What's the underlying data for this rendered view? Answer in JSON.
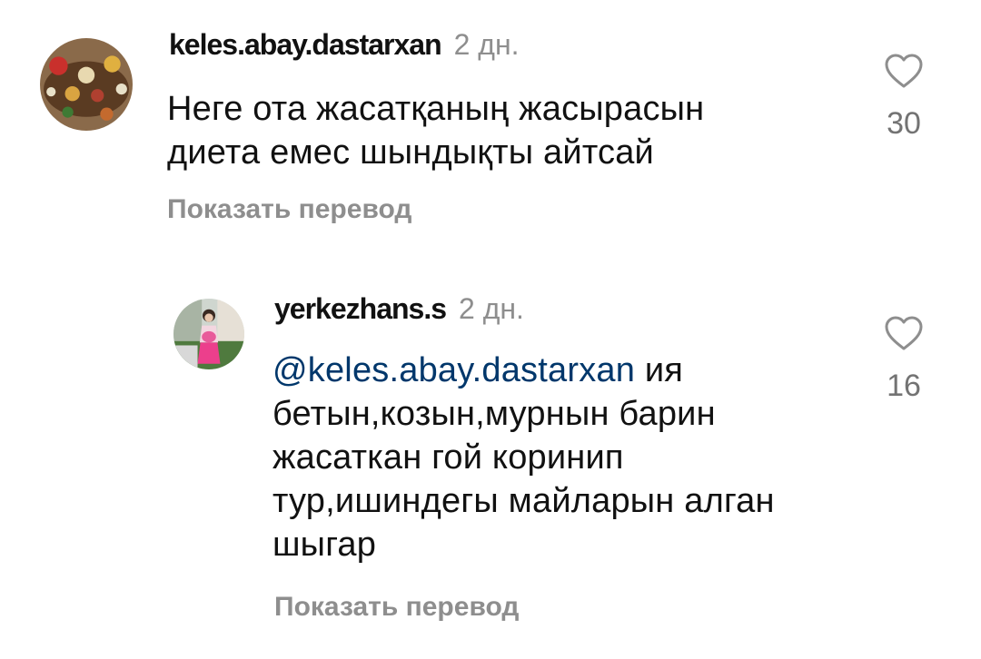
{
  "comments": [
    {
      "username": "keles.abay.dastarxan",
      "time": "2 дн.",
      "text_lines": [
        "Неге ота жасатқаның жасырасын",
        "диета емес шындықты айтсай"
      ],
      "translate_label": "Показать перевод",
      "like_count": "30",
      "icons": {
        "like": "heart-icon",
        "avatar": "profile-picture"
      }
    },
    {
      "username": "yerkezhans.s",
      "time": "2 дн.",
      "mention": "@keles.abay.dastarxan",
      "first_line_rest": " ия",
      "text_lines": [
        "бетын,козын,мурнын барин",
        "жасаткан гой коринип",
        "тур,ишиндегы майларын алган",
        "шыгар"
      ],
      "translate_label": "Показать перевод",
      "like_count": "16",
      "icons": {
        "like": "heart-icon",
        "avatar": "profile-picture"
      }
    }
  ],
  "colors": {
    "text": "#111111",
    "secondary": "#8e8e8e",
    "mention": "#00376b",
    "like_count": "#737373"
  }
}
